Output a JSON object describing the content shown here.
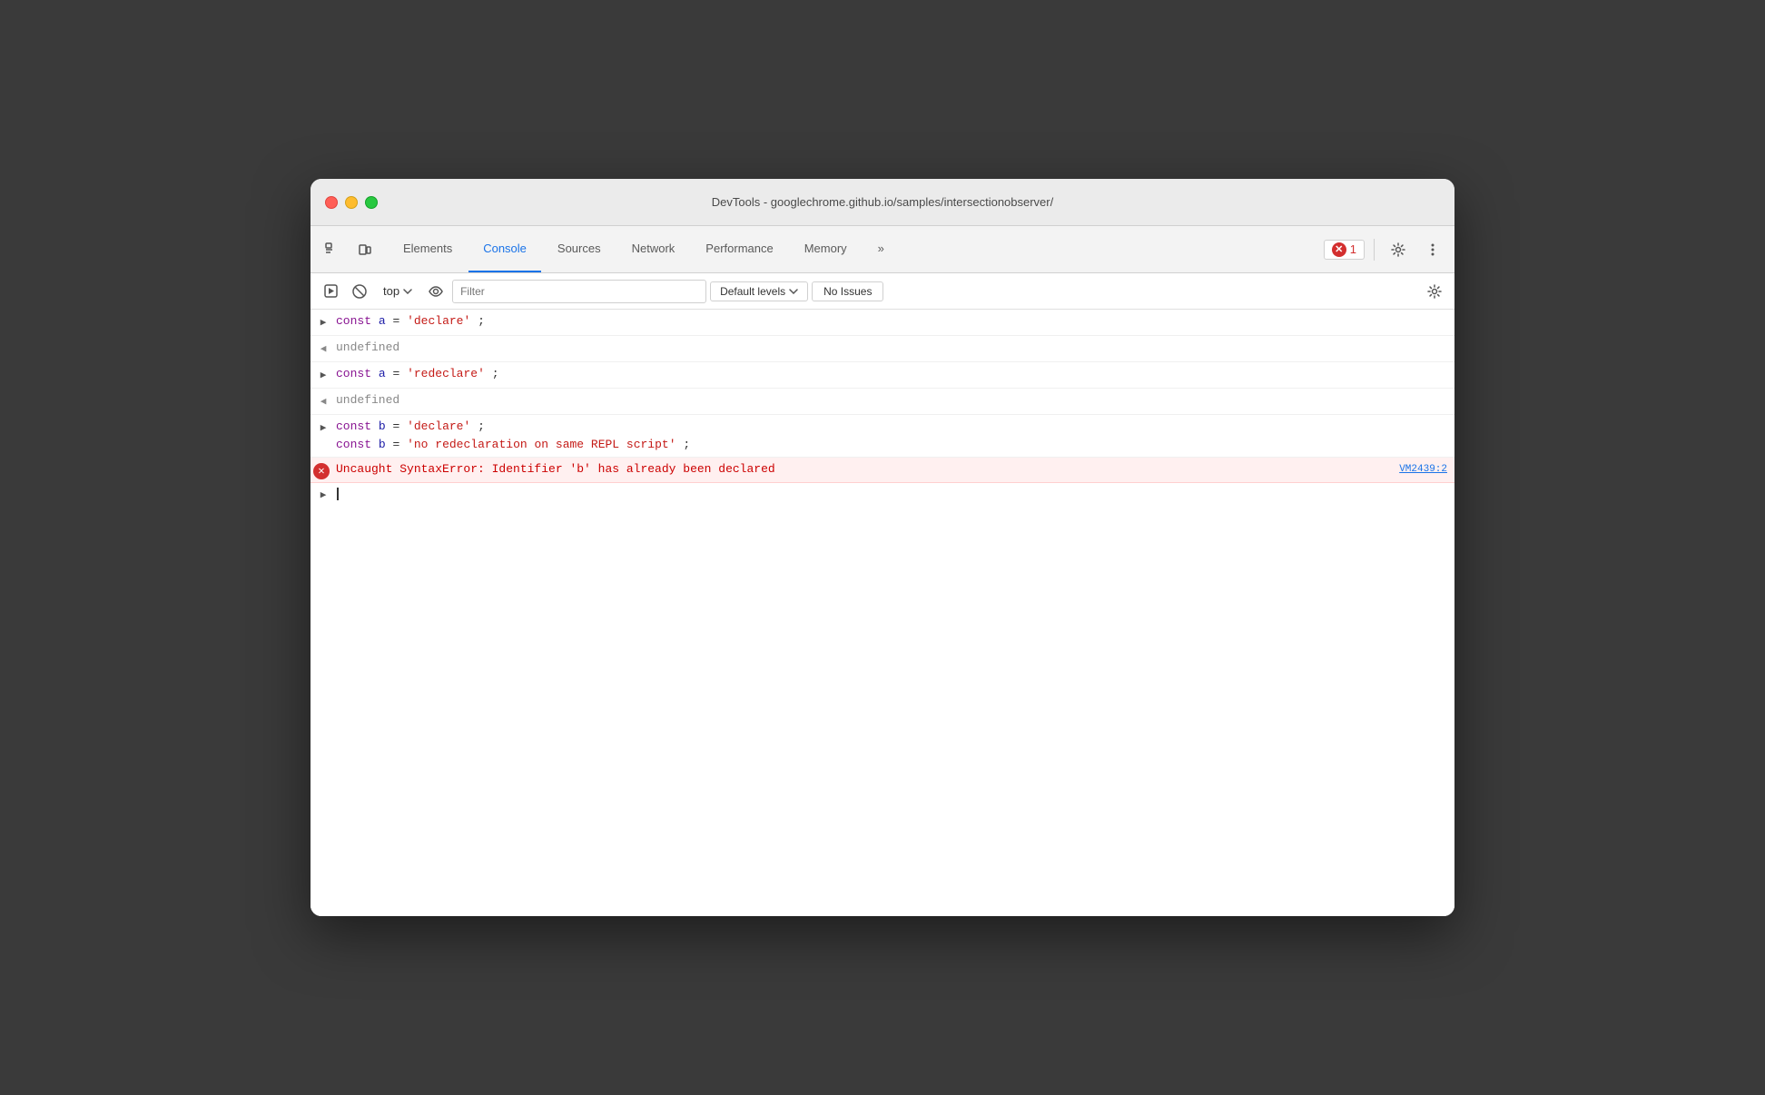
{
  "window": {
    "title": "DevTools - googlechrome.github.io/samples/intersectionobserver/"
  },
  "tabs": {
    "items": [
      {
        "id": "elements",
        "label": "Elements",
        "active": false
      },
      {
        "id": "console",
        "label": "Console",
        "active": true
      },
      {
        "id": "sources",
        "label": "Sources",
        "active": false
      },
      {
        "id": "network",
        "label": "Network",
        "active": false
      },
      {
        "id": "performance",
        "label": "Performance",
        "active": false
      },
      {
        "id": "memory",
        "label": "Memory",
        "active": false
      }
    ],
    "more_label": "»",
    "error_count": "1",
    "settings_label": "⚙",
    "more_dots": "⋮"
  },
  "toolbar": {
    "run_label": "▶",
    "clear_label": "🚫",
    "context": "top",
    "eye_label": "👁",
    "filter_placeholder": "Filter",
    "levels_label": "Default levels",
    "no_issues_label": "No Issues",
    "settings_label": "⚙"
  },
  "console_lines": [
    {
      "type": "input",
      "content": "const a = 'declare';"
    },
    {
      "type": "output",
      "content": "undefined"
    },
    {
      "type": "input",
      "content": "const a = 'redeclare';"
    },
    {
      "type": "output",
      "content": "undefined"
    },
    {
      "type": "input-multi",
      "lines": [
        "const b = 'declare';",
        "const b = 'no redeclaration on same REPL script';"
      ]
    },
    {
      "type": "error",
      "content": "Uncaught SyntaxError: Identifier 'b' has already been declared",
      "source": "VM2439:2"
    }
  ]
}
